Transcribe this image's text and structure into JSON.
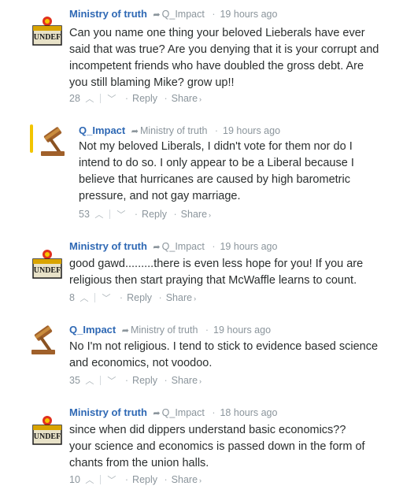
{
  "comments": [
    {
      "author": "Ministry of truth",
      "reply_to": "Q_Impact",
      "time": "19 hours ago",
      "avatar": "ministry-avatar",
      "lines": [
        "Can you name one thing your beloved Lieberals have ever",
        "said that was true? Are you denying that it is your corrupt and",
        "incompetent friends who have doubled the gross debt. Are",
        "you still blaming Mike? grow up!!"
      ],
      "votes": "28",
      "reply_label": "Reply",
      "share_label": "Share"
    },
    {
      "author": "Q_Impact",
      "reply_to": "Ministry of truth",
      "time": "19 hours ago",
      "avatar": "gavel-avatar",
      "highlighted": true,
      "lines": [
        "Not my beloved Liberals, I didn't vote for them nor do I",
        "intend to do so. I only appear to be a Liberal because I",
        "believe that hurricanes are caused by high barometric",
        "pressure, and not gay marriage."
      ],
      "votes": "53",
      "reply_label": "Reply",
      "share_label": "Share"
    },
    {
      "author": "Ministry of truth",
      "reply_to": "Q_Impact",
      "time": "19 hours ago",
      "avatar": "ministry-avatar",
      "lines": [
        "good gawd.........there is even less hope for you! If you are",
        "religious then start praying that McWaffle learns to count."
      ],
      "votes": "8",
      "reply_label": "Reply",
      "share_label": "Share"
    },
    {
      "author": "Q_Impact",
      "reply_to": "Ministry of truth",
      "time": "19 hours ago",
      "avatar": "gavel-avatar",
      "lines": [
        "No I'm not religious. I tend to stick to evidence based science",
        "and economics, not voodoo."
      ],
      "votes": "35",
      "reply_label": "Reply",
      "share_label": "Share"
    },
    {
      "author": "Ministry of truth",
      "reply_to": "Q_Impact",
      "time": "18 hours ago",
      "avatar": "ministry-avatar",
      "lines": [
        "since when did dippers understand basic economics??",
        "your science and economics is passed down in the form of",
        "chants from the union halls."
      ],
      "votes": "10",
      "reply_label": "Reply",
      "share_label": "Share"
    }
  ],
  "avatars": {
    "ministry-avatar": {
      "text": "UNDEF",
      "colors": [
        "#e8e2c8",
        "#1a1a1a",
        "#d9a400",
        "#e0301e"
      ]
    },
    "gavel-avatar": {
      "colors": [
        "#a0602a",
        "#c98c3e",
        "#f0d9a8"
      ]
    }
  }
}
